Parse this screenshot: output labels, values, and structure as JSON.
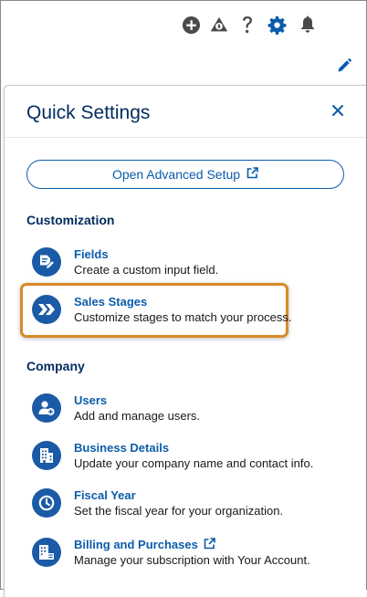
{
  "topbar": {
    "icons": [
      "add-icon",
      "trailhead-icon",
      "help-icon",
      "setup-gear-icon",
      "notifications-bell-icon"
    ],
    "edit_icon": "pencil-icon",
    "accent_color": "#0b5cab"
  },
  "panel": {
    "title": "Quick Settings",
    "advanced_setup_label": "Open Advanced Setup"
  },
  "customization": {
    "heading": "Customization",
    "items": [
      {
        "title": "Fields",
        "description": "Create a custom input field.",
        "icon": "fields-edit-icon"
      },
      {
        "title": "Sales Stages",
        "description": "Customize stages to match your process.",
        "icon": "stages-chevrons-icon"
      }
    ]
  },
  "company": {
    "heading": "Company",
    "items": [
      {
        "title": "Users",
        "description": "Add and manage users.",
        "icon": "user-add-icon"
      },
      {
        "title": "Business Details",
        "description": "Update your company name and contact info.",
        "icon": "building-icon"
      },
      {
        "title": "Fiscal Year",
        "description": "Set the fiscal year for your organization.",
        "icon": "clock-icon"
      },
      {
        "title": "Billing and Purchases",
        "description": "Manage your subscription with Your Account.",
        "icon": "billing-building-icon"
      }
    ]
  },
  "colors": {
    "title_navy": "#032d60",
    "link_blue": "#0b5cab",
    "icon_circle": "#1b5aa6",
    "highlight_orange": "#d78a28"
  }
}
